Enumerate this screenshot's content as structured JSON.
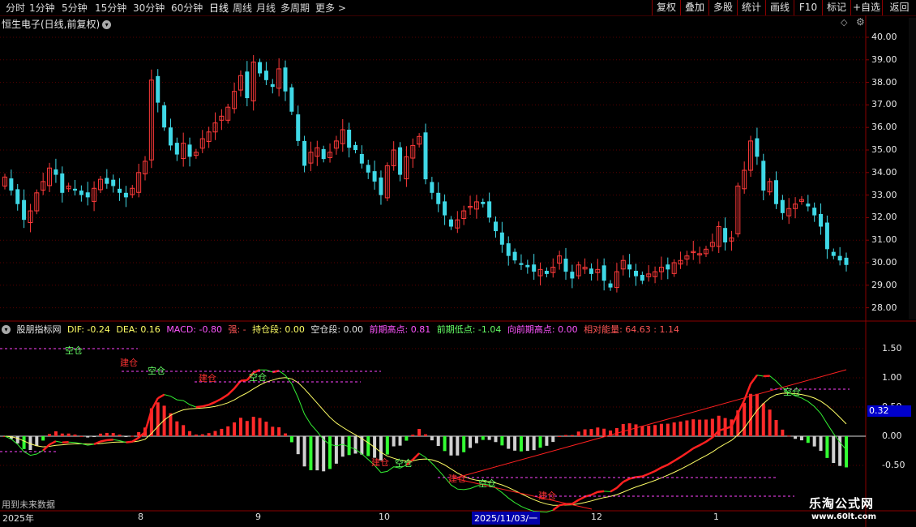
{
  "toolbar": {
    "timeframes": [
      "分时",
      "1分钟",
      "5分钟",
      "15分钟",
      "30分钟",
      "60分钟",
      "日线",
      "周线",
      "月线",
      "多周期",
      "更多 >"
    ],
    "active_timeframe": "日线",
    "right_buttons": [
      "复权",
      "叠加",
      "多股",
      "统计",
      "画线",
      "F10",
      "标记",
      "+自选",
      "返回"
    ]
  },
  "stock": {
    "title": "恒生电子(日线,前复权)",
    "chevron": "chevron-down-icon"
  },
  "price_axis": [
    "40.00",
    "39.00",
    "38.00",
    "37.00",
    "36.00",
    "35.00",
    "34.00",
    "33.00",
    "32.00",
    "31.00",
    "30.00",
    "29.00",
    "28.00"
  ],
  "indicator": {
    "name": "股朋指标网",
    "dif": "DIF: -0.24",
    "dea": "DEA: 0.16",
    "macd": "MACD: -0.80",
    "strong": "强: -",
    "hold": "持仓段: 0.00",
    "empty": "空仓段: 0.00",
    "prev_high": "前期高点: 0.81",
    "prev_low": "前期低点: -1.04",
    "toward_high": "向前期高点: 0.00",
    "rel_energy": "相对能量: 64.63 : 1.14",
    "axis": [
      "1.50",
      "1.00",
      "0.50",
      "0.00",
      "-0.50"
    ],
    "current_value": "0.32",
    "note": "用到未来数据",
    "signals": {
      "buy": "建仓",
      "hold": "持仓",
      "empty": "空仓",
      "add": "加仓"
    }
  },
  "date_axis": [
    "2025年",
    "8",
    "9",
    "10",
    "2025/11/03/一",
    "12",
    "1"
  ],
  "watermark": {
    "title": "乐淘公式网",
    "url": "www.60lt.com"
  },
  "colors": {
    "up": "#ff3a3a",
    "down": "#3fd8e6",
    "dif": "#ffff66",
    "dea": "#33ee33",
    "grid": "#5a0000",
    "hist_pos": "#ff2a2a",
    "hist_neg_g": "#33ff33",
    "hist_neg_w": "#d0d0d0"
  },
  "chart_data": {
    "type": "candlestick",
    "ohlc_close": [
      33.8,
      33.2,
      32.6,
      31.9,
      32.3,
      33.1,
      33.6,
      34.2,
      33.9,
      33.1,
      33.4,
      33.2,
      33.0,
      32.9,
      33.3,
      33.7,
      33.5,
      33.4,
      33.1,
      32.9,
      33.3,
      34.0,
      34.5,
      38.1,
      37.1,
      36.0,
      35.2,
      34.8,
      35.3,
      34.7,
      34.9,
      35.5,
      35.8,
      36.2,
      36.5,
      36.9,
      37.6,
      38.3,
      37.3,
      38.9,
      38.4,
      38.1,
      37.8,
      38.6,
      37.6,
      36.7,
      35.4,
      34.3,
      34.9,
      35.1,
      34.6,
      34.9,
      35.4,
      35.9,
      35.1,
      35.0,
      34.4,
      34.0,
      33.6,
      33.0,
      34.3,
      35.0,
      33.9,
      34.7,
      35.2,
      35.6,
      33.7,
      33.1,
      32.6,
      32.1,
      31.6,
      31.9,
      32.3,
      32.5,
      32.7,
      32.6,
      32.0,
      31.4,
      30.8,
      30.3,
      30.1,
      29.9,
      29.8,
      29.6,
      29.7,
      29.5,
      29.8,
      30.3,
      29.6,
      29.3,
      29.9,
      29.8,
      29.5,
      29.7,
      29.2,
      28.9,
      29.6,
      30.1,
      29.7,
      29.4,
      29.2,
      29.5,
      29.6,
      29.8,
      29.7,
      30.0,
      30.1,
      30.3,
      30.5,
      30.4,
      30.6,
      30.9,
      31.6,
      30.9,
      31.1,
      33.4,
      34.1,
      35.4,
      34.7,
      33.2,
      33.6,
      32.6,
      32.2,
      32.4,
      32.6,
      32.8,
      32.5,
      32.1,
      31.6,
      30.6,
      30.3,
      30.1,
      29.9
    ],
    "ylim": [
      28,
      40
    ],
    "macd": {
      "ylim": [
        -1.1,
        1.8
      ]
    }
  }
}
